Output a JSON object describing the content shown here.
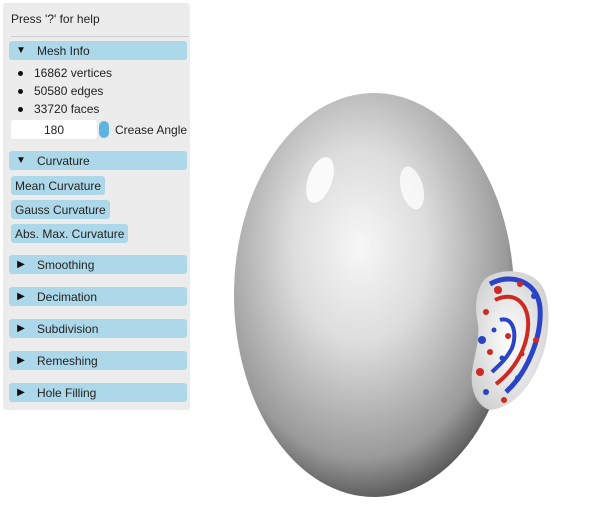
{
  "panel": {
    "help_text": "Press '?' for help",
    "mesh_info": {
      "label": "Mesh Info",
      "vertices": "16862 vertices",
      "edges": "50580 edges",
      "faces": "33720 faces",
      "crease_value": "180",
      "crease_label": "Crease Angle"
    },
    "curvature": {
      "label": "Curvature",
      "buttons": [
        "Mean Curvature",
        "Gauss Curvature",
        "Abs. Max. Curvature"
      ]
    },
    "sections": [
      "Smoothing",
      "Decimation",
      "Subdivision",
      "Remeshing",
      "Hole Filling"
    ]
  },
  "colors": {
    "panel_bg": "#ececec",
    "header_bg": "#add8ea",
    "slider_knob": "#5fb3e0",
    "curvature_red": "#cc2a22",
    "curvature_blue": "#2a44c8"
  },
  "icons": {
    "expanded": "triangle-down-icon",
    "collapsed": "triangle-right-icon"
  }
}
